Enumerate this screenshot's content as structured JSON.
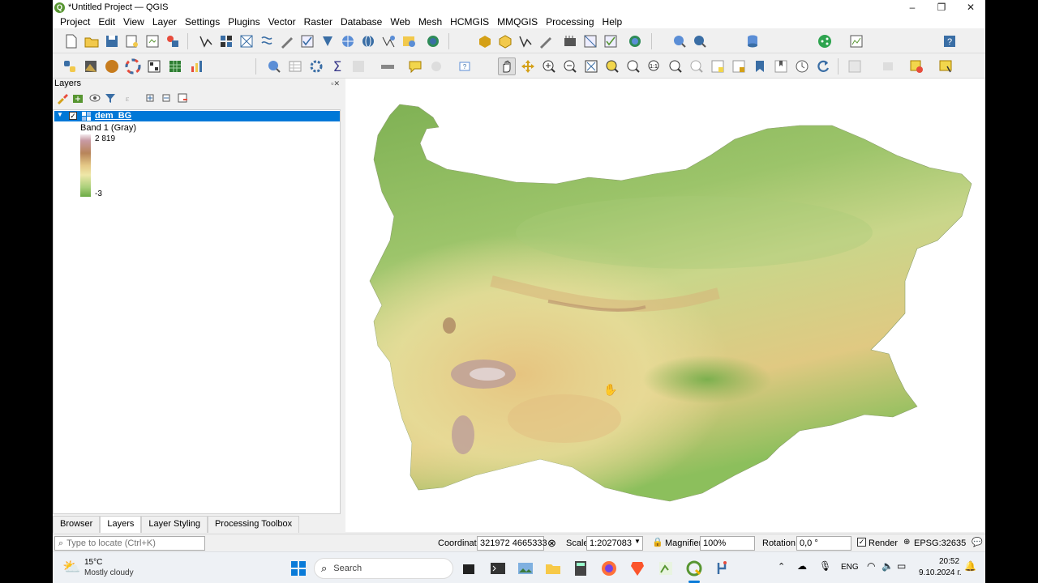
{
  "window": {
    "title": "*Untitled Project — QGIS",
    "logo_letter": "Q",
    "controls": [
      "–",
      "❐",
      "✕"
    ]
  },
  "menu": [
    "Project",
    "Edit",
    "View",
    "Layer",
    "Settings",
    "Plugins",
    "Vector",
    "Raster",
    "Database",
    "Web",
    "Mesh",
    "HCMGIS",
    "MMQGIS",
    "Processing",
    "Help"
  ],
  "layers_panel": {
    "title": "Layers",
    "layer": {
      "name": "dem_BG",
      "checked": true,
      "band_label": "Band 1 (Gray)",
      "max_label": "2 819",
      "min_label": "-3"
    }
  },
  "bottom_tabs": [
    {
      "label": "Browser",
      "selected": false
    },
    {
      "label": "Layers",
      "selected": true
    },
    {
      "label": "Layer Styling",
      "selected": false
    },
    {
      "label": "Processing Toolbox",
      "selected": false
    }
  ],
  "statusbar": {
    "locator_placeholder": "Type to locate (Ctrl+K)",
    "coordinate_label": "Coordinate",
    "coordinate_value": "321972  4665333",
    "scale_label": "Scale",
    "scale_value": "1:2027083",
    "magnifier_label": "Magnifier",
    "magnifier_value": "100%",
    "rotation_label": "Rotation",
    "rotation_value": "0,0 °",
    "render_label": "Render",
    "crs": "EPSG:32635"
  },
  "taskbar": {
    "weather_temp": "15°C",
    "weather_desc": "Mostly cloudy",
    "search_label": "Search",
    "lang": "ENG",
    "time": "20:52",
    "date": "9.10.2024 г."
  },
  "colors": {
    "accent": "#0078d7",
    "qgis_green": "#589632"
  }
}
